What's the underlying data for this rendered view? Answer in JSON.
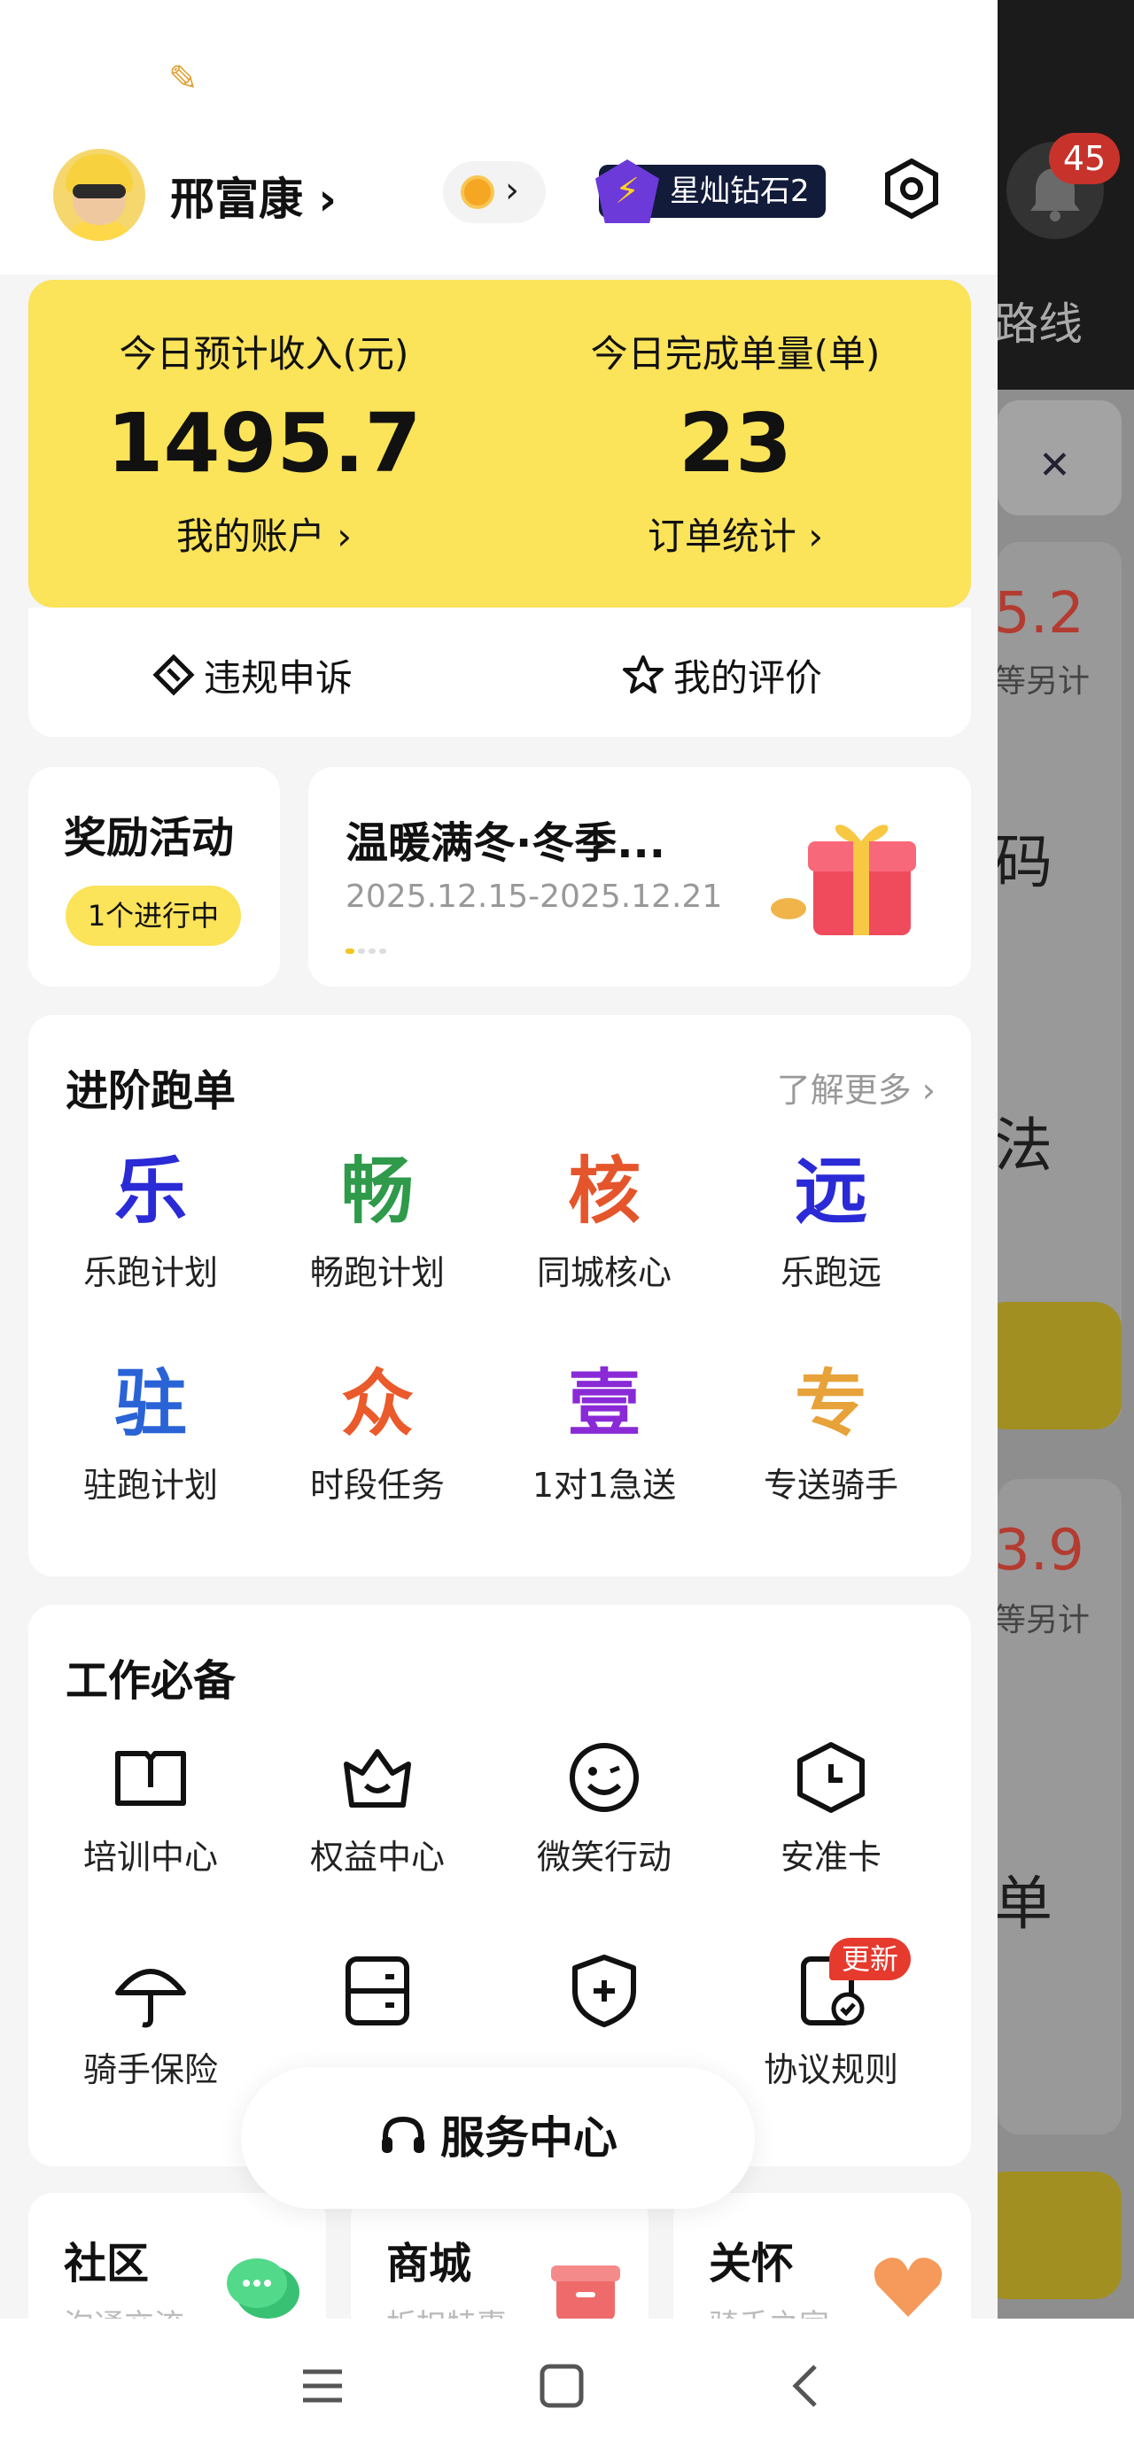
{
  "user": {
    "name": "邢富康",
    "level_badge": "星灿钻石2",
    "notification_count": "45"
  },
  "earnings": {
    "income_label": "今日预计收入(元)",
    "income_value": "1495.7",
    "income_link": "我的账户",
    "orders_label": "今日完成单量(单)",
    "orders_value": "23",
    "orders_link": "订单统计"
  },
  "quick_actions": [
    {
      "label": "违规申诉"
    },
    {
      "label": "我的评价"
    }
  ],
  "rewards": {
    "title": "奖励活动",
    "status": "1个进行中"
  },
  "promo": {
    "title": "温暖满冬·冬季...",
    "date": "2025.12.15-2025.12.21"
  },
  "advanced": {
    "title": "进阶跑单",
    "more": "了解更多",
    "items": [
      {
        "glyph": "乐",
        "label": "乐跑计划",
        "color": "#2a2ad6"
      },
      {
        "glyph": "畅",
        "label": "畅跑计划",
        "color": "#2e9a4a"
      },
      {
        "glyph": "核",
        "label": "同城核心",
        "color": "#e5552c"
      },
      {
        "glyph": "远",
        "label": "乐跑远",
        "color": "#2a2ad6"
      },
      {
        "glyph": "驻",
        "label": "驻跑计划",
        "color": "#2a63d6"
      },
      {
        "glyph": "众",
        "label": "时段任务",
        "color": "#ea5a2a"
      },
      {
        "glyph": "壹",
        "label": "1对1急送",
        "color": "#8a2ad6"
      },
      {
        "glyph": "专",
        "label": "专送骑手",
        "color": "#e7a23a"
      }
    ]
  },
  "work": {
    "title": "工作必备",
    "items": [
      {
        "icon": "book-icon",
        "label": "培训中心"
      },
      {
        "icon": "crown-icon",
        "label": "权益中心"
      },
      {
        "icon": "smile-icon",
        "label": "微笑行动"
      },
      {
        "icon": "clock-shield-icon",
        "label": "安准卡"
      },
      {
        "icon": "umbrella-icon",
        "label": "骑手保险"
      },
      {
        "icon": "card-icon",
        "label": ""
      },
      {
        "icon": "shield-plus-icon",
        "label": ""
      },
      {
        "icon": "agreement-icon",
        "label": "协议规则"
      }
    ],
    "update_badge": "更新"
  },
  "service_center": "服务中心",
  "bottom_cards": [
    {
      "title": "社区",
      "subtitle": "沟通交流"
    },
    {
      "title": "商城",
      "subtitle": "折扣特惠"
    },
    {
      "title": "关怀",
      "subtitle": "骑手之家"
    }
  ],
  "background": {
    "label_route": "路线",
    "amount1": "5.2",
    "sub1": "等另计",
    "label_code": "码",
    "label_fa": "法",
    "amount2": "3.9",
    "sub2": "等另计",
    "label_dan": "单"
  },
  "colors": {
    "accent": "#fbe35a",
    "dark_badge": "#121b3a",
    "update": "#e63a2e"
  }
}
